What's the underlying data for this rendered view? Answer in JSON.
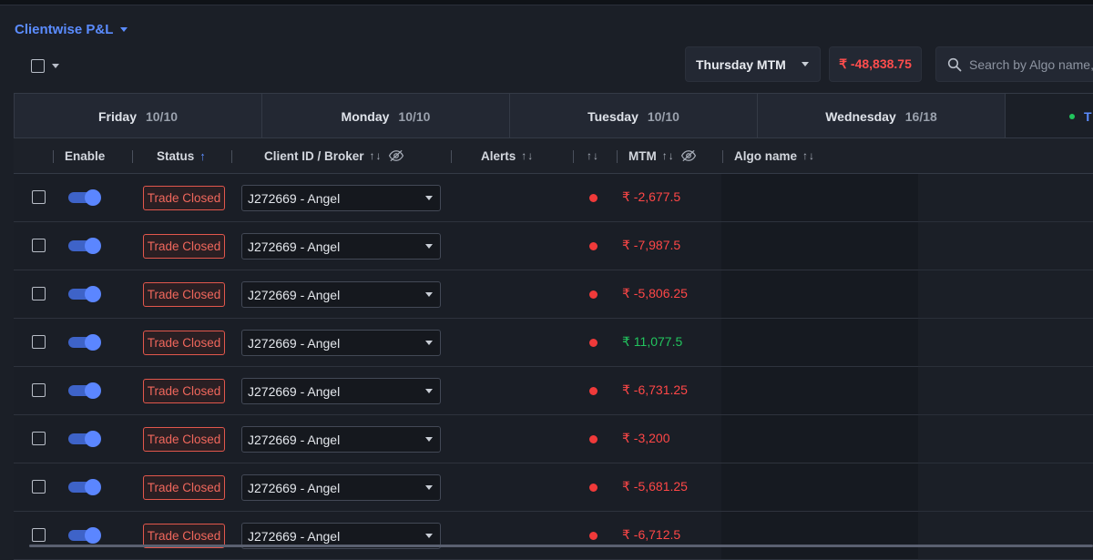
{
  "header": {
    "title": "Clientwise P&L"
  },
  "mtm_selector": {
    "label": "Thursday MTM"
  },
  "total_mtm": {
    "value": "₹ -48,838.75",
    "color": "#ff4d4d"
  },
  "search": {
    "placeholder": "Search by Algo name, "
  },
  "tabs": [
    {
      "day": "Friday",
      "count": "10/10"
    },
    {
      "day": "Monday",
      "count": "10/10"
    },
    {
      "day": "Tuesday",
      "count": "10/10"
    },
    {
      "day": "Wednesday",
      "count": "16/18"
    },
    {
      "day": "T",
      "count": "",
      "active": true
    }
  ],
  "columns": {
    "enable": "Enable",
    "status": "Status",
    "client": "Client ID / Broker",
    "alerts": "Alerts",
    "mtm": "MTM",
    "algo": "Algo name"
  },
  "rows": [
    {
      "status": "Trade Closed",
      "client": "J272669 - Angel",
      "mtm": "₹ -2,677.5",
      "mtm_sign": "neg"
    },
    {
      "status": "Trade Closed",
      "client": "J272669 - Angel",
      "mtm": "₹ -7,987.5",
      "mtm_sign": "neg"
    },
    {
      "status": "Trade Closed",
      "client": "J272669 - Angel",
      "mtm": "₹ -5,806.25",
      "mtm_sign": "neg"
    },
    {
      "status": "Trade Closed",
      "client": "J272669 - Angel",
      "mtm": "₹ 11,077.5",
      "mtm_sign": "pos"
    },
    {
      "status": "Trade Closed",
      "client": "J272669 - Angel",
      "mtm": "₹ -6,731.25",
      "mtm_sign": "neg"
    },
    {
      "status": "Trade Closed",
      "client": "J272669 - Angel",
      "mtm": "₹ -3,200",
      "mtm_sign": "neg"
    },
    {
      "status": "Trade Closed",
      "client": "J272669 - Angel",
      "mtm": "₹ -5,681.25",
      "mtm_sign": "neg"
    },
    {
      "status": "Trade Closed",
      "client": "J272669 - Angel",
      "mtm": "₹ -6,712.5",
      "mtm_sign": "neg"
    }
  ],
  "colors": {
    "accent": "#5b8cff",
    "negative": "#ff4747",
    "positive": "#22c55e",
    "alert": "#f03a3a"
  }
}
